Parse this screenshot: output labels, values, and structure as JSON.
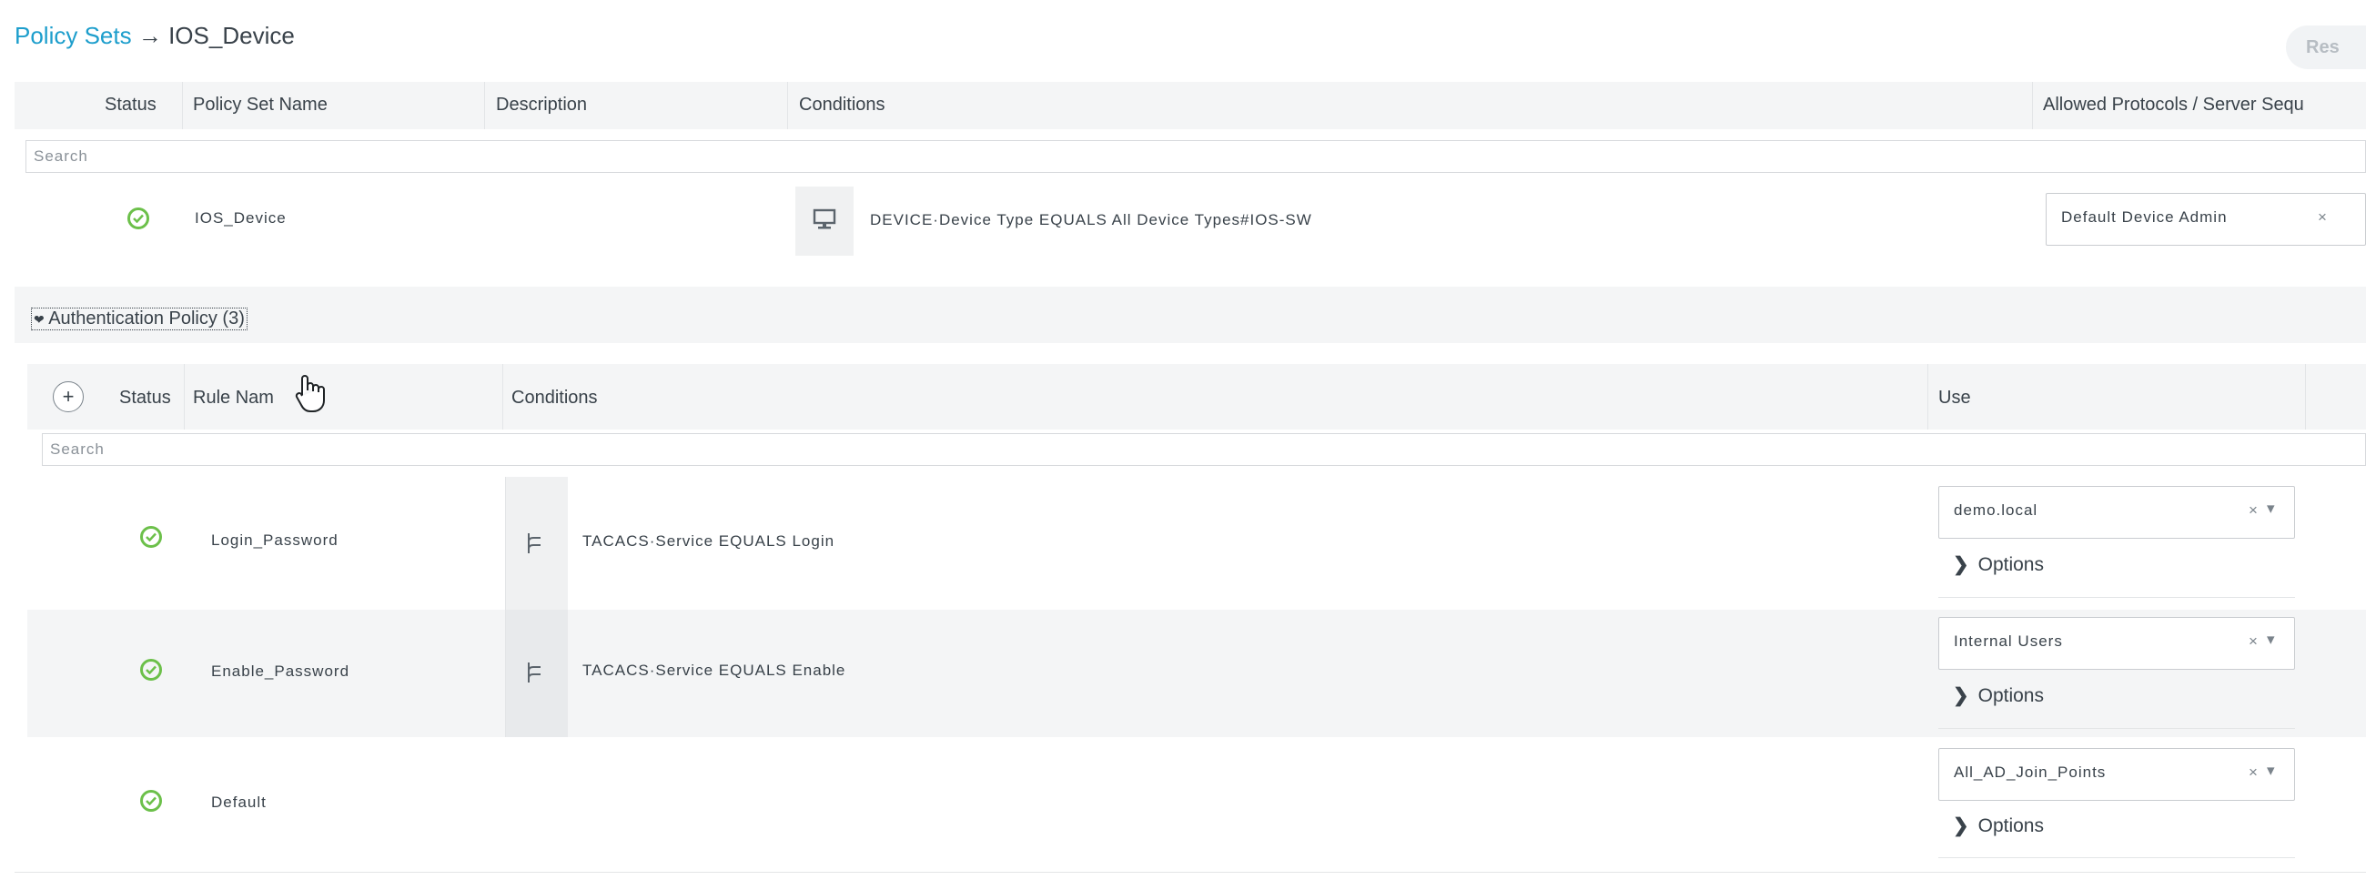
{
  "breadcrumb": {
    "parent": "Policy Sets",
    "arrow": "→",
    "current": "IOS_Device"
  },
  "reset_button_label": "Res",
  "policy_set_table": {
    "headers": {
      "status": "Status",
      "name": "Policy Set Name",
      "description": "Description",
      "conditions": "Conditions",
      "allowed": "Allowed Protocols / Server Sequ"
    },
    "search_placeholder": "Search",
    "row": {
      "name": "IOS_Device",
      "condition": "DEVICE·Device Type EQUALS All Device Types#IOS-SW",
      "allowed_protocol": "Default Device Admin",
      "allowed_clear": "×"
    }
  },
  "auth_policy": {
    "toggle_label": "Authentication Policy (3)",
    "add": "+",
    "headers": {
      "status": "Status",
      "rule_name": "Rule Nam",
      "conditions": "Conditions",
      "use": "Use"
    },
    "search_placeholder": "Search",
    "rules": [
      {
        "name": "Login_Password",
        "condition": "TACACS·Service EQUALS Login",
        "use": "demo.local",
        "options": "Options"
      },
      {
        "name": "Enable_Password",
        "condition": "TACACS·Service EQUALS Enable",
        "use": "Internal Users",
        "options": "Options"
      },
      {
        "name": "Default",
        "condition": "",
        "use": "All_AD_Join_Points",
        "options": "Options"
      }
    ],
    "select_clear": "×",
    "select_arrow": "▾"
  },
  "colors": {
    "link": "#1d9ecc",
    "status_ok": "#6cc04a",
    "text": "#39424a"
  }
}
